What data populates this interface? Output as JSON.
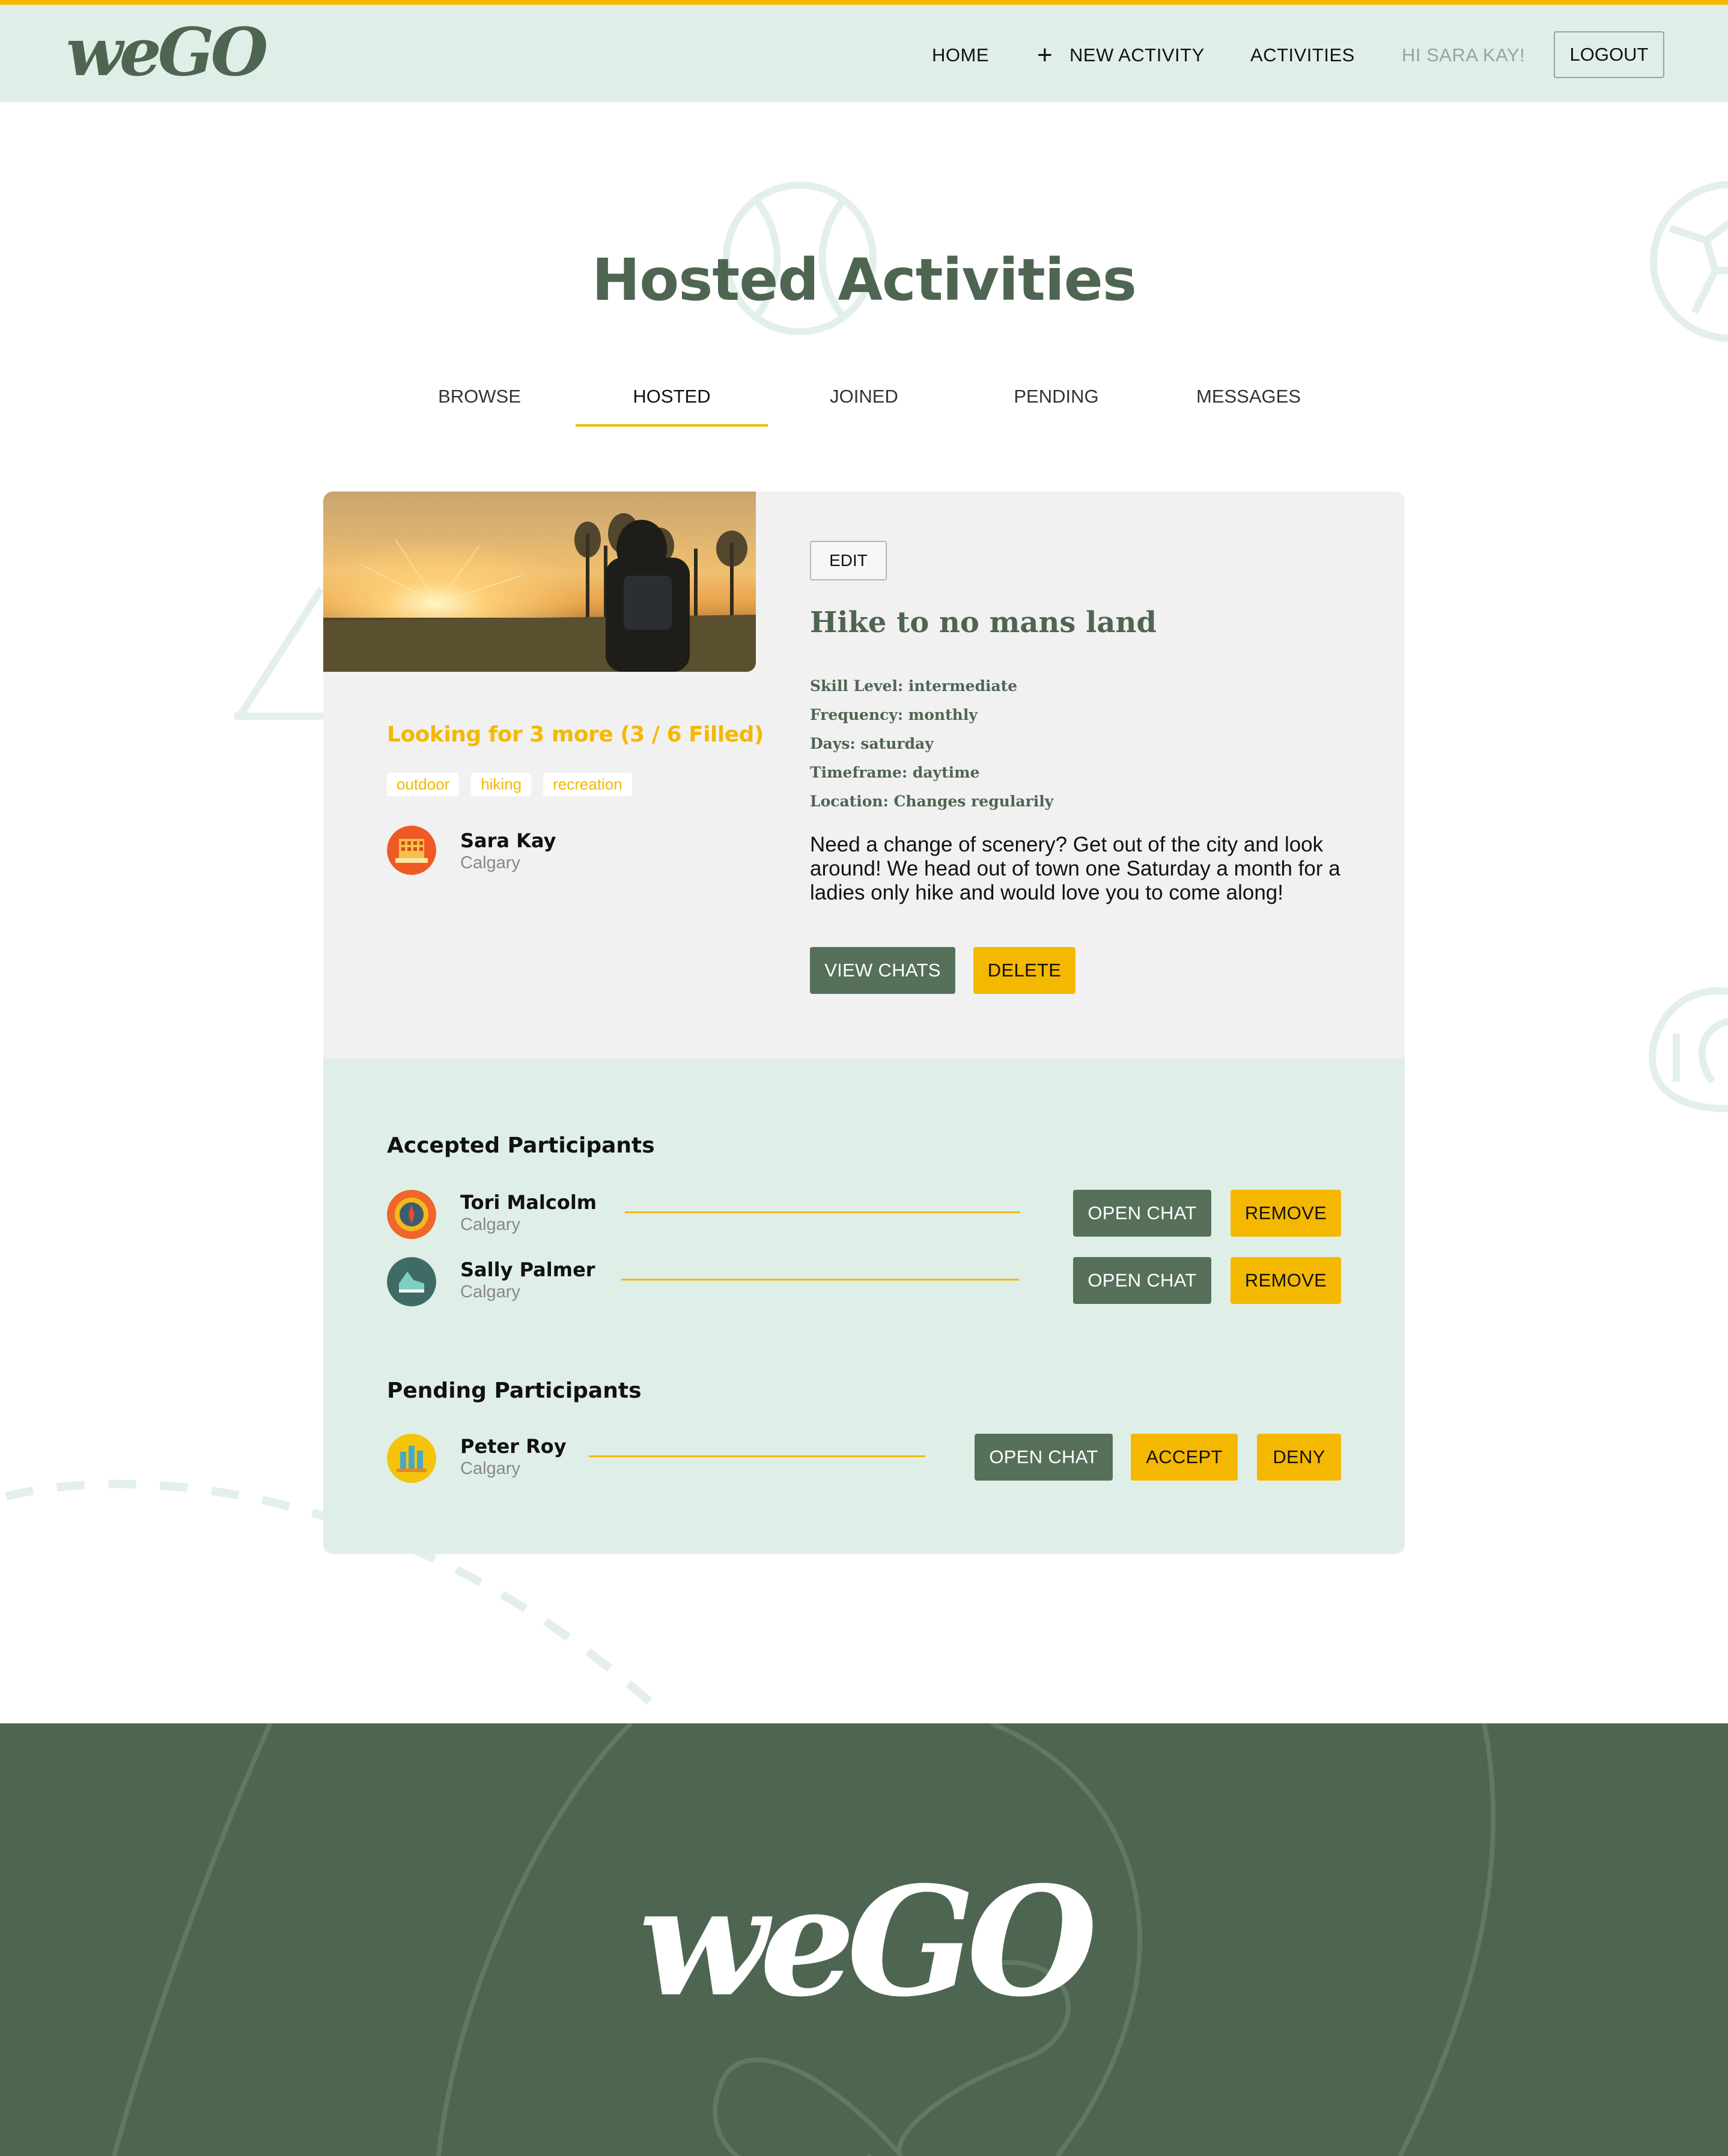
{
  "colors": {
    "accent": "#f5b800",
    "brand_green": "#4e6552",
    "button_green": "#56705a",
    "mint": "#e0eee8",
    "card_gray": "#f1f1f1"
  },
  "nav": {
    "logo": "weGO",
    "home": "HOME",
    "new_activity": "NEW ACTIVITY",
    "activities": "ACTIVITIES",
    "greeting": "HI SARA KAY!",
    "logout": "LOGOUT"
  },
  "page": {
    "title": "Hosted Activities",
    "tabs": [
      "BROWSE",
      "HOSTED",
      "JOINED",
      "PENDING",
      "MESSAGES"
    ],
    "active_tab": "HOSTED"
  },
  "activity": {
    "image_alt": "hiker-with-backpack-at-sunrise",
    "looking": "Looking for 3 more (3 / 6 Filled)",
    "tags": [
      "outdoor",
      "hiking",
      "recreation"
    ],
    "host": {
      "name": "Sara Kay",
      "city": "Calgary",
      "avatar": "building-icon"
    },
    "edit": "EDIT",
    "title": "Hike to no mans land",
    "details": {
      "skill": "Skill Level: intermediate",
      "frequency": "Frequency: monthly",
      "days": "Days: saturday",
      "timeframe": "Timeframe: daytime",
      "location": "Location: Changes regularily"
    },
    "description": "Need a change of scenery? Get out of the city and look around! We head out of town one Saturday a month for a ladies only hike and would love you to come along!",
    "view_chats": "VIEW CHATS",
    "delete": "DELETE"
  },
  "accepted": {
    "heading": "Accepted Participants",
    "participants": [
      {
        "name": "Tori Malcolm",
        "city": "Calgary",
        "avatar": "compass-icon",
        "open_chat": "OPEN CHAT",
        "remove": "REMOVE"
      },
      {
        "name": "Sally Palmer",
        "city": "Calgary",
        "avatar": "sneaker-icon",
        "open_chat": "OPEN CHAT",
        "remove": "REMOVE"
      }
    ]
  },
  "pending": {
    "heading": "Pending Participants",
    "participants": [
      {
        "name": "Peter Roy",
        "city": "Calgary",
        "avatar": "city-icon",
        "open_chat": "OPEN CHAT",
        "accept": "ACCEPT",
        "deny": "DENY"
      }
    ]
  },
  "footer": {
    "logo": "weGO"
  }
}
